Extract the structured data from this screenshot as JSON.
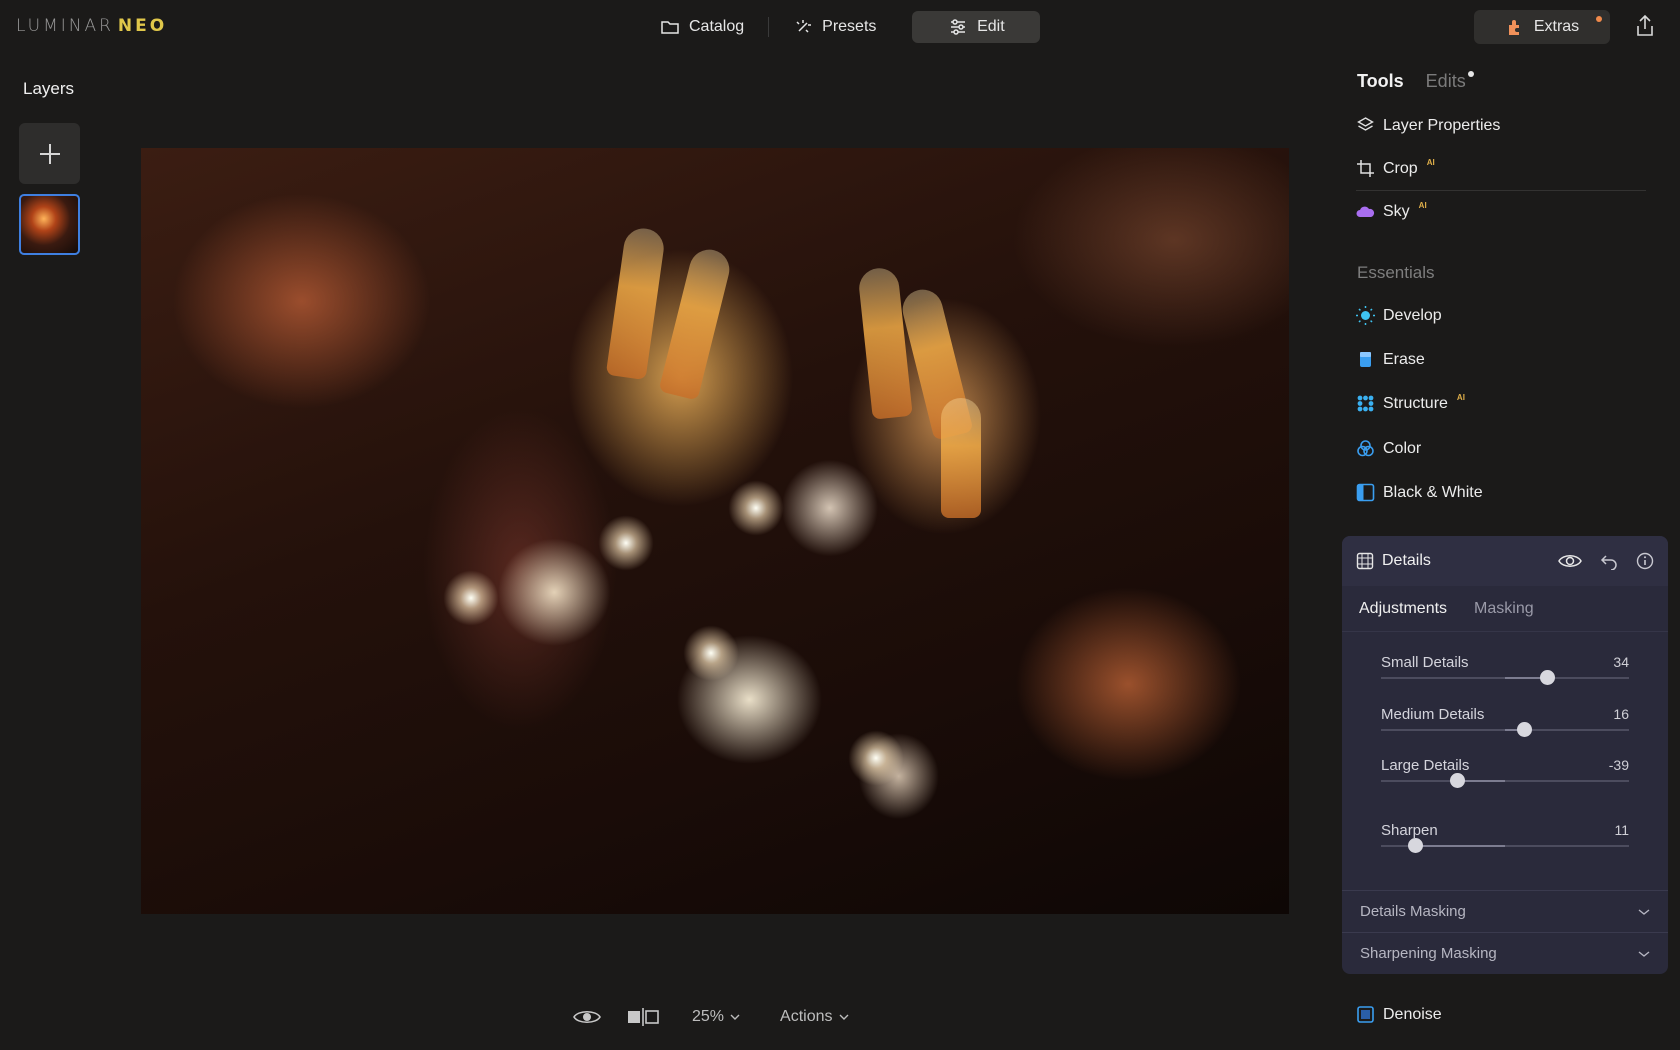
{
  "app": {
    "logo_text": "LUMINAR",
    "logo_accent": "NEO"
  },
  "nav": {
    "catalog": "Catalog",
    "presets": "Presets",
    "edit": "Edit",
    "extras": "Extras"
  },
  "layers": {
    "title": "Layers"
  },
  "bottom": {
    "zoom": "25%",
    "actions": "Actions"
  },
  "right_panel": {
    "tab_tools": "Tools",
    "tab_edits": "Edits",
    "tools": [
      {
        "label": "Layer Properties",
        "icon": "layers-icon",
        "ai": ""
      },
      {
        "label": "Crop",
        "icon": "crop-icon",
        "ai": "AI"
      },
      {
        "label": "Sky",
        "icon": "cloud-icon",
        "ai": "AI"
      }
    ],
    "section": "Essentials",
    "essentials": [
      {
        "label": "Develop",
        "icon": "sun-icon",
        "ai": ""
      },
      {
        "label": "Erase",
        "icon": "eraser-icon",
        "ai": ""
      },
      {
        "label": "Structure",
        "icon": "structure-icon",
        "ai": "AI"
      },
      {
        "label": "Color",
        "icon": "color-icon",
        "ai": ""
      },
      {
        "label": "Black & White",
        "icon": "bw-icon",
        "ai": ""
      }
    ],
    "details": {
      "title": "Details",
      "subtab_adjustments": "Adjustments",
      "subtab_masking": "Masking",
      "sliders": [
        {
          "label": "Small Details",
          "value": "34",
          "level": 0.67
        },
        {
          "label": "Medium Details",
          "value": "16",
          "level": 0.58
        },
        {
          "label": "Large Details",
          "value": "-39",
          "level": 0.31
        },
        {
          "label": "Sharpen",
          "value": "11",
          "level": 0.14
        }
      ],
      "accordion_details_masking": "Details Masking",
      "accordion_sharpening_masking": "Sharpening Masking"
    },
    "denoise": "Denoise"
  },
  "colors": {
    "accent_blue": "#3f7fe0",
    "ai_badge": "#e0b04a",
    "details_panel_bg": "#2a2a3b"
  }
}
